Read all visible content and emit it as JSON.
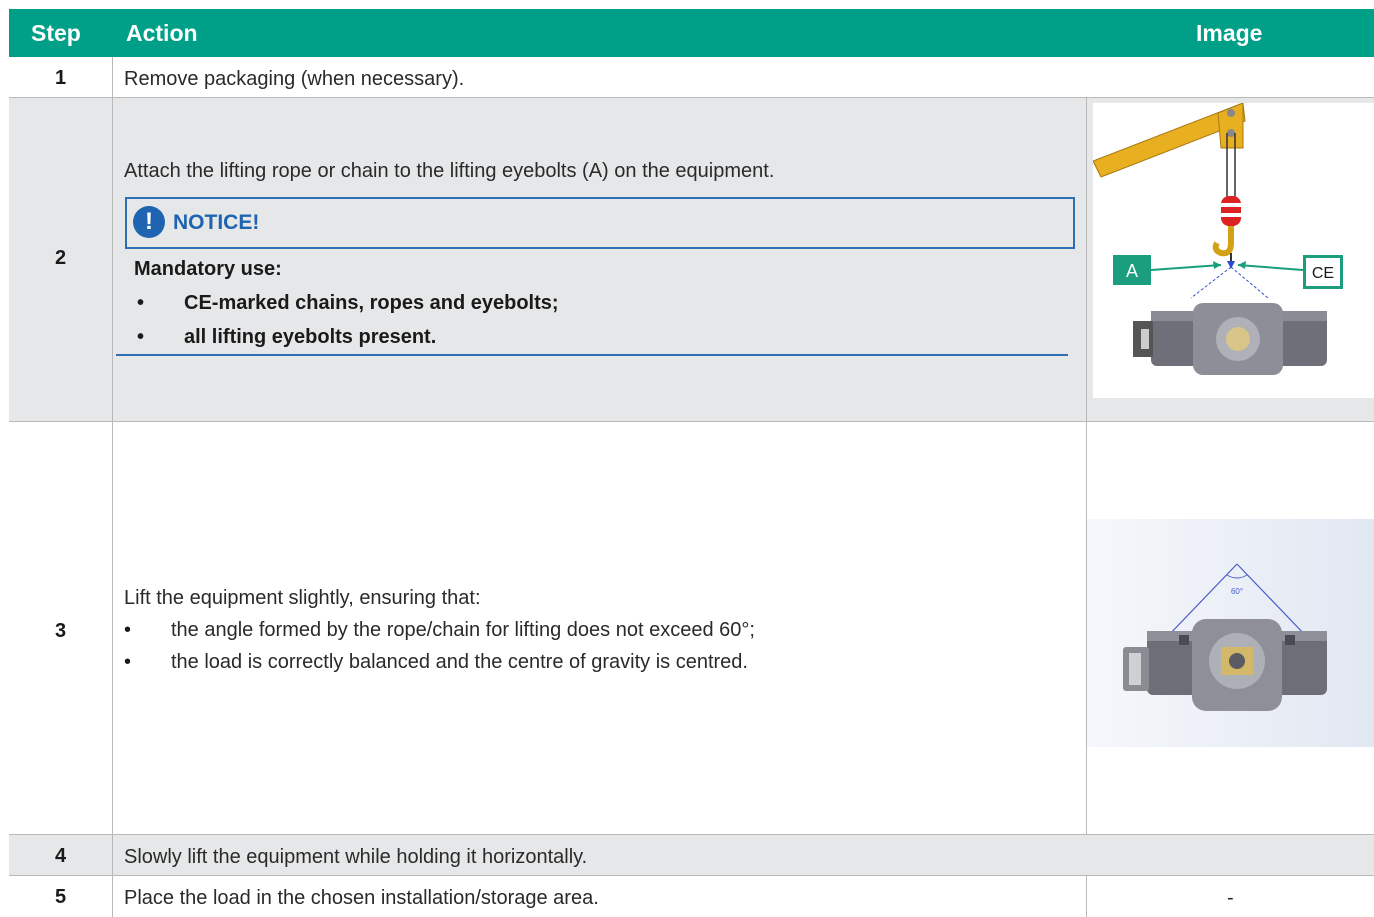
{
  "header": {
    "step": "Step",
    "action": "Action",
    "image": "Image"
  },
  "rows": [
    {
      "step": "1",
      "action": "Remove packaging (when necessary)."
    },
    {
      "step": "2",
      "action": "Attach the lifting rope or chain to the lifting eyebolts (A) on the equipment.",
      "notice": {
        "title": "NOTICE!",
        "lead": "Mandatory use:",
        "items": [
          "CE-marked chains, ropes and eyebolts;",
          "all lifting eyebolts present."
        ]
      },
      "image_labels": {
        "a": "A",
        "ce": "CE"
      }
    },
    {
      "step": "3",
      "action": "Lift the equipment slightly, ensuring that:",
      "items": [
        "the angle formed by the rope/chain for lifting does not exceed 60°;",
        "the load is correctly balanced and the centre of gravity is centred."
      ],
      "image_labels": {
        "angle": "60°"
      }
    },
    {
      "step": "4",
      "action": "Slowly lift the equipment while holding it horizontally."
    },
    {
      "step": "5",
      "action": "Place the load in the chosen installation/storage area.",
      "image": "-"
    }
  ],
  "colors": {
    "header": "#00a088",
    "notice": "#1f64b0",
    "row_gray": "#e6e7e8",
    "crane": "#e8b020"
  }
}
